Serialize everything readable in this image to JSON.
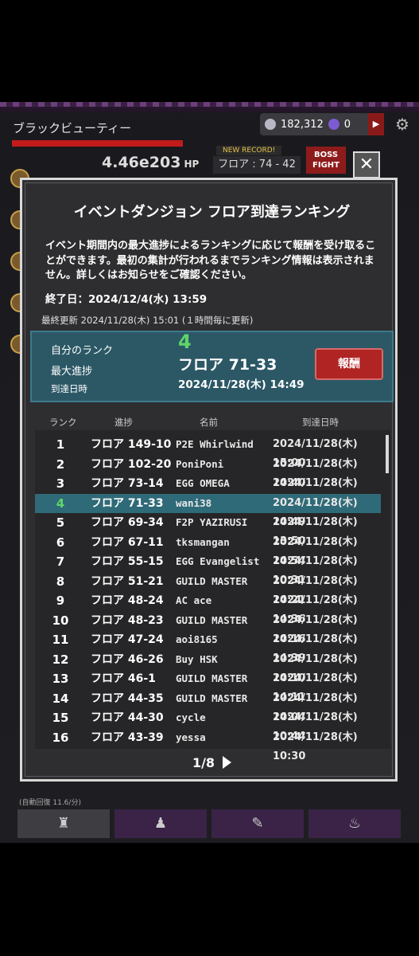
{
  "game": {
    "boss_name": "ブラックビューティー",
    "hp_value": "4.46e203",
    "hp_unit": "HP",
    "coins": "182,312",
    "gems": "0",
    "new_record": "NEW RECORD!",
    "floor": "フロア : 74 - 42",
    "boss_fight_line1": "BOSS",
    "boss_fight_line2": "FIGHT",
    "auto_recover": "(自動回復 11.6/分)",
    "close_label": "✕"
  },
  "modal": {
    "title": "イベントダンジョン フロア到達ランキング",
    "description": "イベント期間内の最大進捗によるランキングに応じて報酬を受け取ることができます。最初の集計が行われるまでランキング情報は表示されません。詳しくはお知らせをご確認ください。",
    "end_date": "終了日：2024/12/4(水) 13:59",
    "last_update": "最終更新 2024/11/28(木) 15:01 (１時間毎に更新)",
    "my_rank": {
      "rank_label": "自分のランク",
      "rank_value": "4",
      "progress_label": "最大進捗",
      "progress_value": "フロア 71-33",
      "date_label": "到達日時",
      "date_value": "2024/11/28(木) 14:49",
      "reward_button": "報酬"
    },
    "table": {
      "headers": {
        "rank": "ランク",
        "progress": "進捗",
        "name": "名前",
        "date": "到達日時"
      },
      "rows": [
        {
          "rank": "1",
          "floor": "フロア 149-10",
          "name": "P2E Whirlwind",
          "date": "2024/11/28(木)  15:00"
        },
        {
          "rank": "2",
          "floor": "フロア 102-20",
          "name": "PoniPoni",
          "date": "2024/11/28(木)  14:40"
        },
        {
          "rank": "3",
          "floor": "フロア 73-14",
          "name": "EGG OMEGA",
          "date": "2024/11/28(木)  14:47"
        },
        {
          "rank": "4",
          "floor": "フロア 71-33",
          "name": "wani38",
          "date": "2024/11/28(木)  14:49"
        },
        {
          "rank": "5",
          "floor": "フロア 69-34",
          "name": "F2P  YAZIRUSI",
          "date": "2024/11/28(木)  13:50"
        },
        {
          "rank": "6",
          "floor": "フロア 67-11",
          "name": "tksmangan",
          "date": "2024/11/28(木)  14:54"
        },
        {
          "rank": "7",
          "floor": "フロア 55-15",
          "name": "EGG Evangelist",
          "date": "2024/11/28(木)  10:31"
        },
        {
          "rank": "8",
          "floor": "フロア 51-21",
          "name": "GUILD MASTER",
          "date": "2024/11/28(木)  14:21"
        },
        {
          "rank": "9",
          "floor": "フロア 48-24",
          "name": "AC ace",
          "date": "2024/11/28(木)  14:36"
        },
        {
          "rank": "10",
          "floor": "フロア 48-23",
          "name": "GUILD MASTER",
          "date": "2024/11/28(木)  14:16"
        },
        {
          "rank": "11",
          "floor": "フロア 47-24",
          "name": "aoi8165",
          "date": "2024/11/28(木)  14:39"
        },
        {
          "rank": "12",
          "floor": "フロア 46-26",
          "name": "Buy HSK",
          "date": "2024/11/28(木)  14:10"
        },
        {
          "rank": "13",
          "floor": "フロア 46-1",
          "name": "GUILD MASTER",
          "date": "2024/11/28(木)  14:11"
        },
        {
          "rank": "14",
          "floor": "フロア 44-35",
          "name": "GUILD MASTER",
          "date": "2024/11/28(木)  14:04"
        },
        {
          "rank": "15",
          "floor": "フロア 44-30",
          "name": "cycle",
          "date": "2024/11/28(木)  10:44"
        },
        {
          "rank": "16",
          "floor": "フロア 43-39",
          "name": "yessa",
          "date": "2024/11/28(木)  10:30"
        }
      ],
      "highlight_rank": "4"
    },
    "pager": "1/8"
  }
}
